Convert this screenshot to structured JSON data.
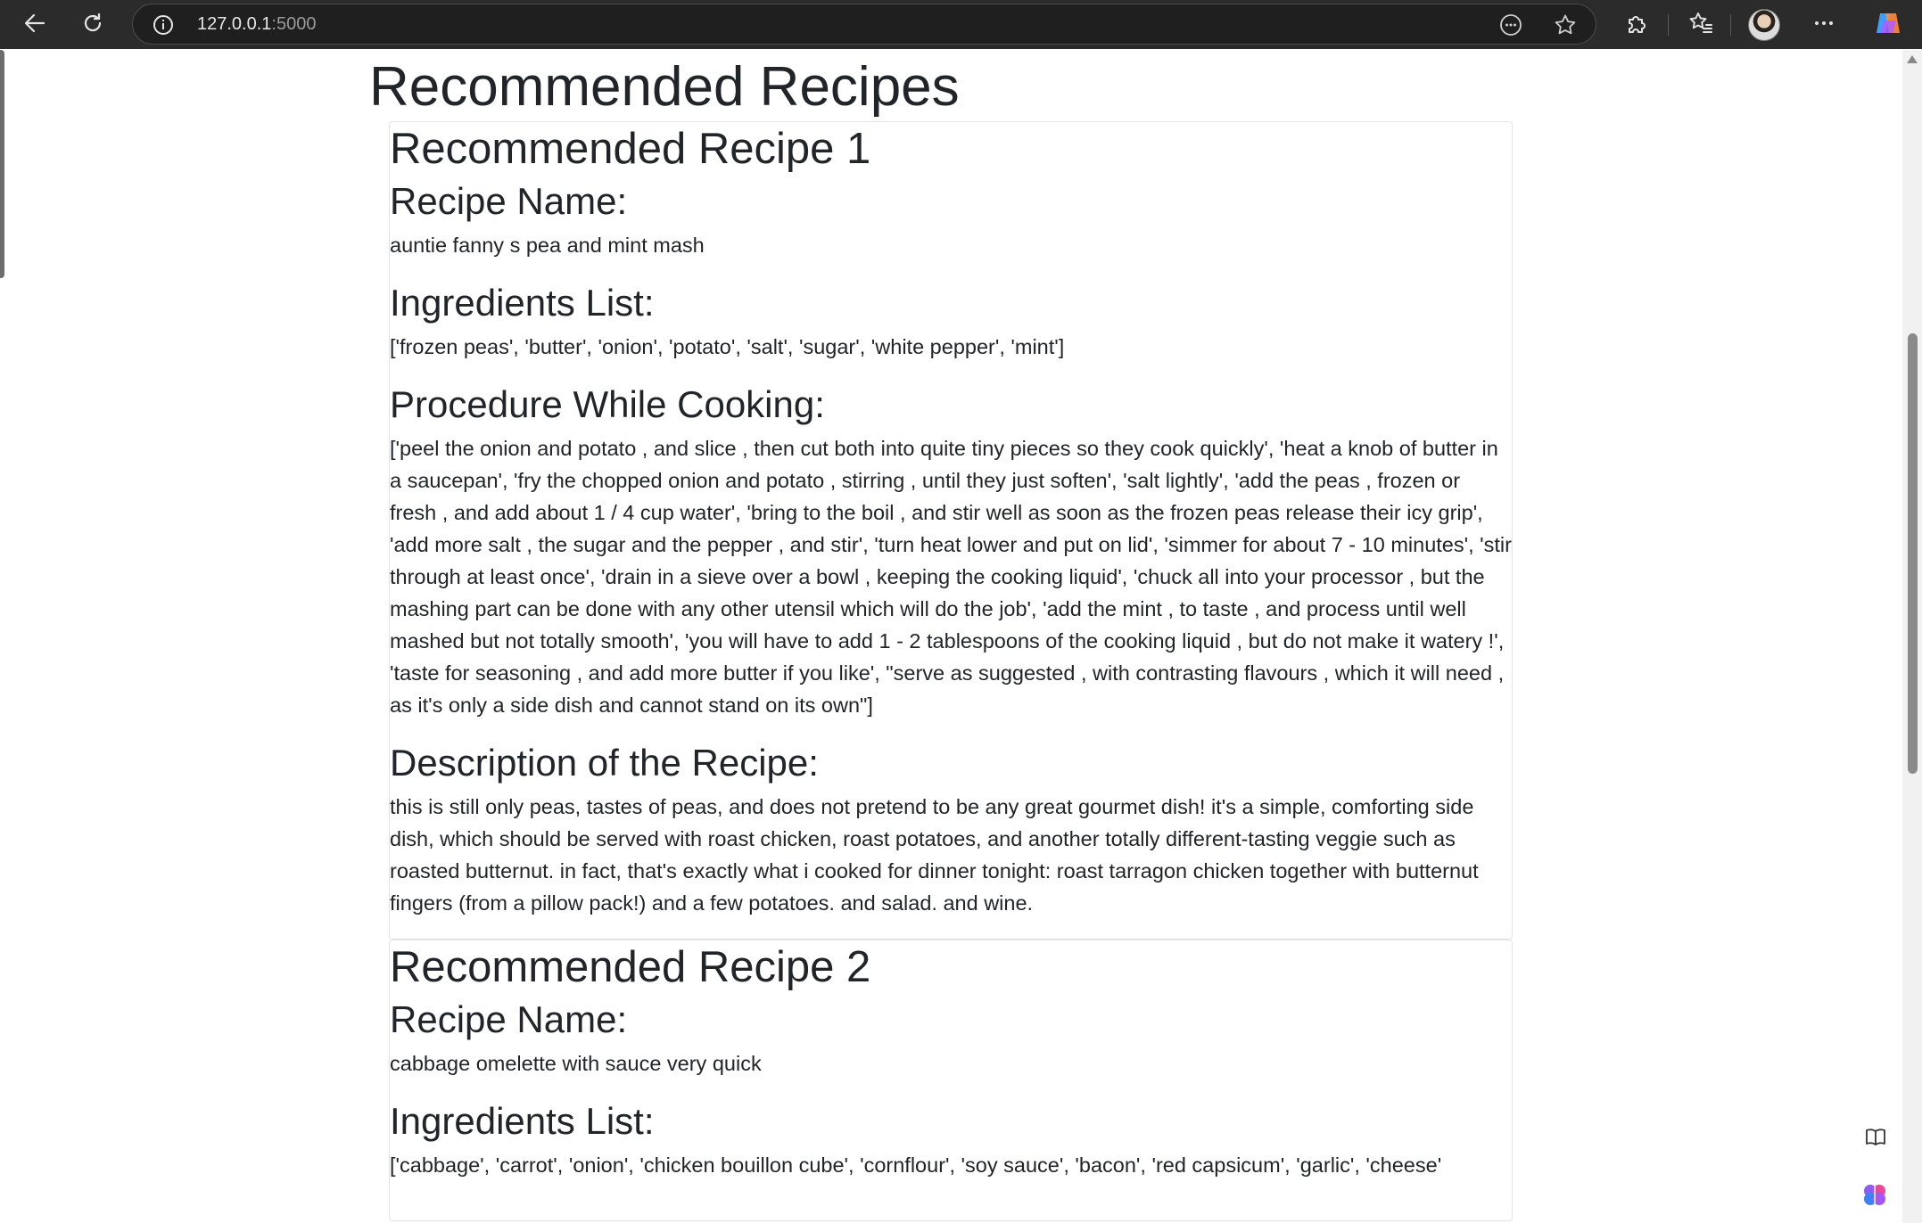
{
  "browser": {
    "url_host": "127.0.0.1",
    "url_port": ":5000",
    "icons": [
      "back-icon",
      "refresh-icon",
      "site-info-icon",
      "reader-icon",
      "favorite-star-icon",
      "extensions-icon",
      "favorites-icon",
      "more-icon",
      "copilot-icon"
    ]
  },
  "page": {
    "title": "Recommended Recipes",
    "labels": {
      "name": "Recipe Name:",
      "ingredients": "Ingredients List:",
      "procedure": "Procedure While Cooking:",
      "description": "Description of the Recipe:"
    },
    "recipes": [
      {
        "heading": "Recommended Recipe 1",
        "name": "auntie fanny s pea and mint mash",
        "ingredients": "['frozen peas', 'butter', 'onion', 'potato', 'salt', 'sugar', 'white pepper', 'mint']",
        "procedure": "['peel the onion and potato , and slice , then cut both into quite tiny pieces so they cook quickly', 'heat a knob of butter in a saucepan', 'fry the chopped onion and potato , stirring , until they just soften', 'salt lightly', 'add the peas , frozen or fresh , and add about 1 / 4 cup water', 'bring to the boil , and stir well as soon as the frozen peas release their icy grip', 'add more salt , the sugar and the pepper , and stir', 'turn heat lower and put on lid', 'simmer for about 7 - 10 minutes', 'stir through at least once', 'drain in a sieve over a bowl , keeping the cooking liquid', 'chuck all into your processor , but the mashing part can be done with any other utensil which will do the job', 'add the mint , to taste , and process until well mashed but not totally smooth', 'you will have to add 1 - 2 tablespoons of the cooking liquid , but do not make it watery !', 'taste for seasoning , and add more butter if you like', \"serve as suggested , with contrasting flavours , which it will need , as it's only a side dish and cannot stand on its own\"]",
        "description": "this is still only peas, tastes of peas, and does not pretend to be any great gourmet dish! it's a simple, comforting side dish, which should be served with roast chicken, roast potatoes, and another totally different-tasting veggie such as roasted butternut. in fact, that's exactly what i cooked for dinner tonight: roast tarragon chicken together with butternut fingers (from a pillow pack!) and a few potatoes. and salad. and wine."
      },
      {
        "heading": "Recommended Recipe 2",
        "name": "cabbage omelette with sauce very quick",
        "ingredients": "['cabbage', 'carrot', 'onion', 'chicken bouillon cube', 'cornflour', 'soy sauce', 'bacon', 'red capsicum', 'garlic', 'cheese'"
      }
    ]
  }
}
